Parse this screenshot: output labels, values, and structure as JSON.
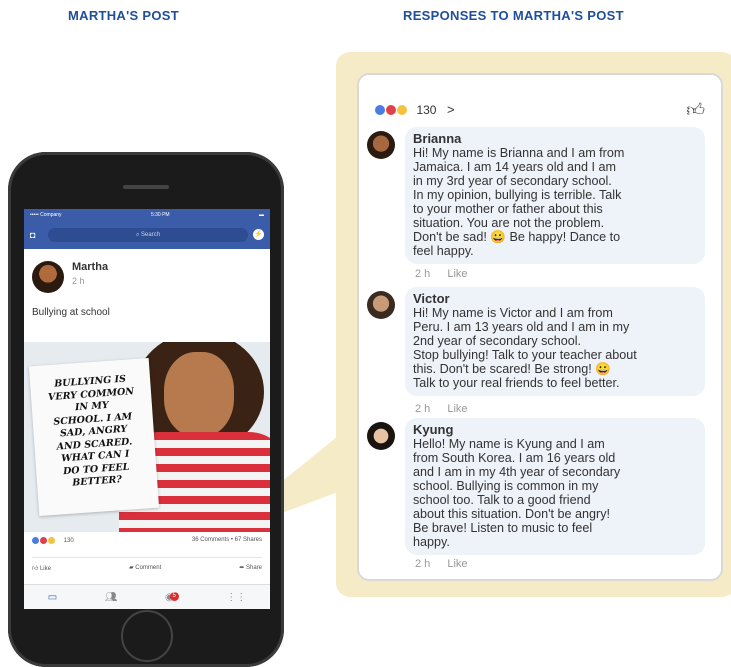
{
  "headings": {
    "left": "MARTHA'S POST",
    "right": "RESPONSES TO MARTHA'S POST"
  },
  "phone": {
    "status_left": "••••• Company",
    "status_time": "5:30 PM",
    "search_placeholder": "Search",
    "post": {
      "author": "Martha",
      "time": "2 h",
      "text": "Bullying at school",
      "sign_text": "BULLYING IS\nVERY COMMON\nIN MY\nSCHOOL. I AM\nSAD, ANGRY\nAND SCARED.\nWHAT CAN I\nDO TO FEEL\nBETTER?",
      "reaction_count": "130",
      "comments_shares": "36 Comments • 67 Shares",
      "actions": [
        "Like",
        "Comment",
        "Share"
      ],
      "notification_badge": "5"
    }
  },
  "responses": {
    "reaction_count": "130",
    "comments": [
      {
        "name": "Brianna",
        "text": "Hi! My name is Brianna and I am from\nJamaica. I am 14 years old and I am\nin my 3rd year of secondary school.\nIn my opinion, bullying is terrible. Talk\nto your mother or father about this\nsituation. You are not the problem.\nDon't be sad! 😀 Be happy!  Dance to\nfeel happy.",
        "time": "2 h",
        "like": "Like"
      },
      {
        "name": "Victor",
        "text": "Hi!  My name is Victor and I am from\nPeru. I am 13 years old and I am in my\n2nd year of secondary school.\nStop bullying! Talk to your teacher about\nthis. Don't be scared! Be strong! 😀\nTalk to your real friends to feel better.",
        "time": "2 h",
        "like": "Like"
      },
      {
        "name": "Kyung",
        "text": "Hello! My name is Kyung and I am\nfrom South Korea. I am 16 years old\nand I am in my 4th year of secondary\nschool. Bullying is common in my\nschool too. Talk to a good friend\nabout this situation. Don't be angry!\nBe brave! Listen to music to feel\nhappy.",
        "time": "2 h",
        "like": "Like"
      }
    ]
  },
  "colors": {
    "heading": "#1f4e9c",
    "facebook_blue": "#3b5ca8",
    "panel_bg": "#f6ebc7",
    "bubble_bg": "#eef2f9"
  }
}
